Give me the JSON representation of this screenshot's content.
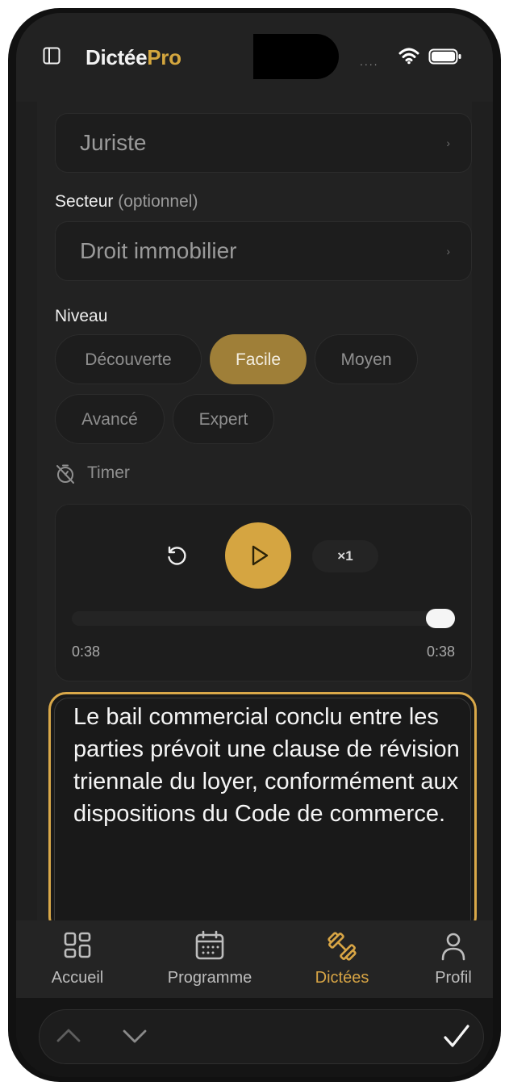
{
  "header": {
    "brand_part1": "Dictée",
    "brand_part2": "Pro",
    "signal": "....",
    "accent_color": "#d4a63e"
  },
  "form": {
    "profession_value": "Juriste",
    "sector_label": "Secteur",
    "sector_optional": "(optionnel)",
    "sector_value": "Droit immobilier",
    "level_label": "Niveau",
    "levels": [
      "Découverte",
      "Facile",
      "Moyen",
      "Avancé",
      "Expert"
    ],
    "selected_level": "Facile",
    "timer_label": "Timer"
  },
  "player": {
    "speed": "×1",
    "elapsed": "0:38",
    "duration": "0:38",
    "progress_fraction": 1.0
  },
  "dictation": {
    "text": "Le bail commercial conclu entre les parties prévoit une clause de révision triennale du loyer, conformément aux dispositions du Code de commerce."
  },
  "bottom_nav": {
    "items": [
      {
        "label": "Accueil",
        "icon": "grid-icon"
      },
      {
        "label": "Programme",
        "icon": "calendar-icon"
      },
      {
        "label": "Dictées",
        "icon": "dumbbell-icon"
      },
      {
        "label": "Profil",
        "icon": "person-icon"
      }
    ],
    "active": "Dictées"
  },
  "keyboard_toolbar": {
    "icons": [
      "chevron-up-icon",
      "chevron-down-icon",
      "checkmark-icon"
    ]
  }
}
